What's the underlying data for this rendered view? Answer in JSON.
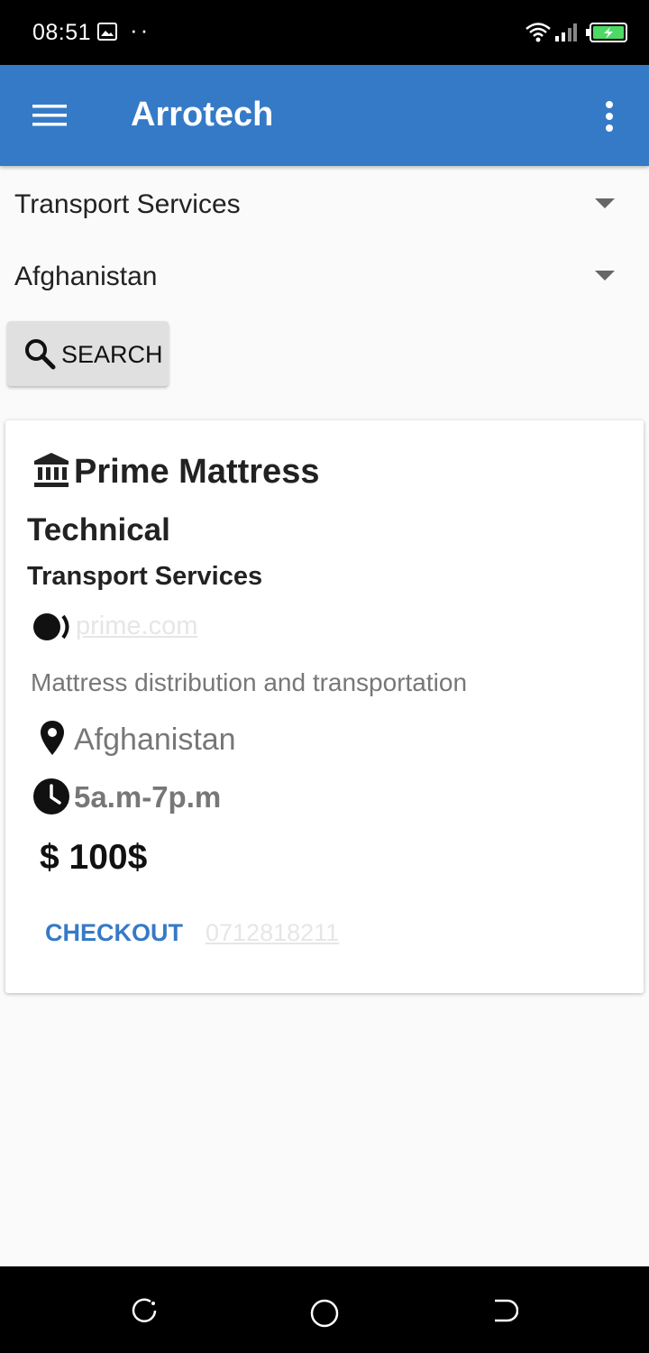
{
  "status_bar": {
    "time": "08:51",
    "dots": "··"
  },
  "app_bar": {
    "title": "Arrotech"
  },
  "filters": {
    "service": "Transport Services",
    "country": "Afghanistan"
  },
  "search": {
    "label": "SEARCH"
  },
  "listing": {
    "title": "Prime Mattress",
    "category": "Technical",
    "service": "Transport Services",
    "website": "prime.com",
    "description": "Mattress distribution and transportation",
    "location": "Afghanistan",
    "hours": "5a.m-7p.m",
    "price": "$ 100$",
    "checkout_label": "CHECKOUT",
    "phone": "0712818211"
  },
  "colors": {
    "accent": "#357ac7",
    "background": "#fafafa"
  }
}
